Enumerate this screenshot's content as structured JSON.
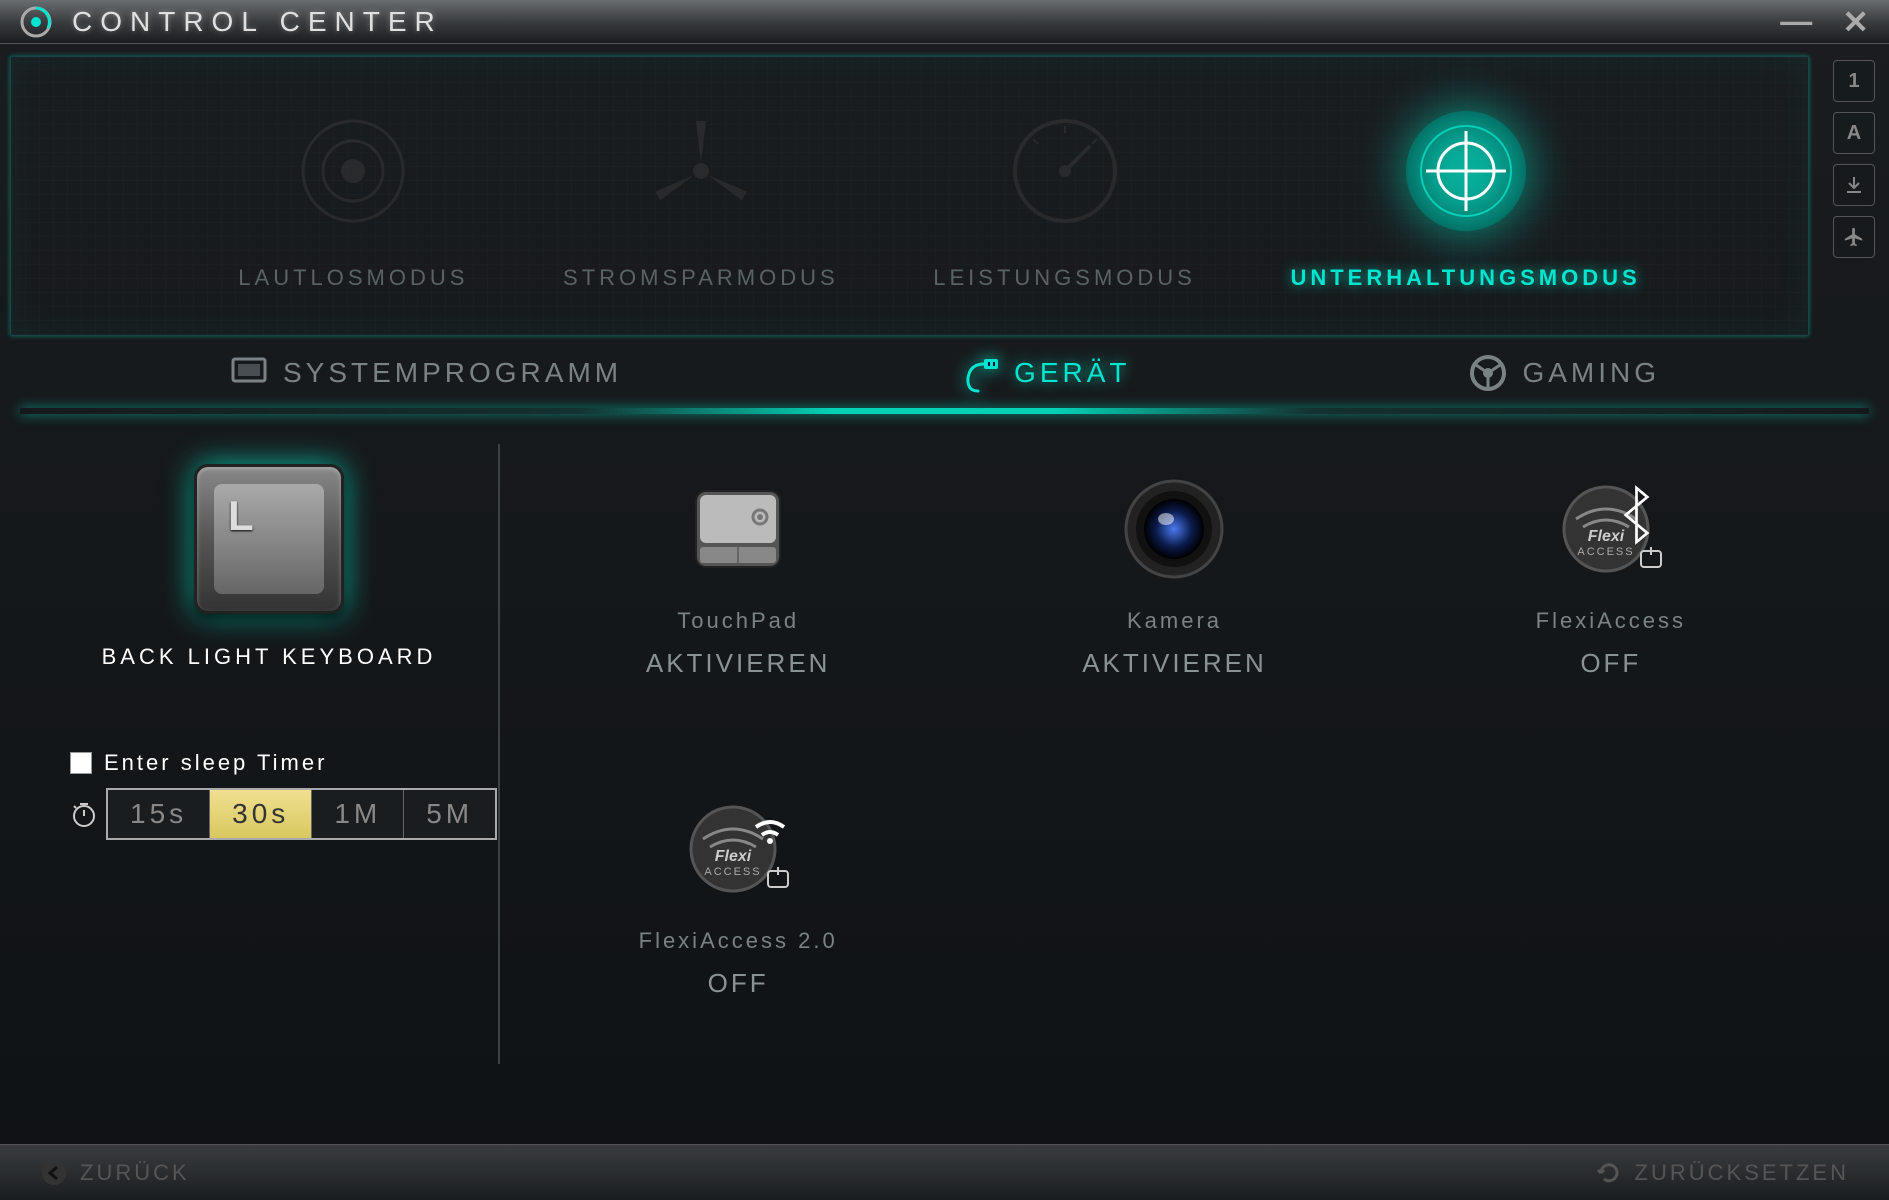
{
  "app": {
    "title": "CONTROL CENTER"
  },
  "modes": {
    "items": [
      {
        "label": "Lautlosmodus",
        "icon": "speaker"
      },
      {
        "label": "Stromsparmodus",
        "icon": "windmill"
      },
      {
        "label": "Leistungsmodus",
        "icon": "gauge"
      },
      {
        "label": "Unterhaltungsmodus",
        "icon": "target"
      }
    ],
    "activeIndex": 3
  },
  "sideIndicators": [
    "1",
    "A",
    "↓",
    "✈"
  ],
  "tabs": {
    "items": [
      {
        "label": "SYSTEMPROGRAMM",
        "icon": "monitor"
      },
      {
        "label": "GERÄT",
        "icon": "plug"
      },
      {
        "label": "GAMING",
        "icon": "wheel"
      }
    ],
    "activeIndex": 1
  },
  "backlight": {
    "label": "BACK LIGHT KEYBOARD",
    "keycap": "L"
  },
  "sleepTimer": {
    "label": "Enter sleep Timer",
    "checked": false,
    "options": [
      "15s",
      "30s",
      "1M",
      "5M"
    ],
    "selectedIndex": 1
  },
  "devices": [
    {
      "title": "TouchPad",
      "status": "AKTIVIEREN",
      "icon": "touchpad"
    },
    {
      "title": "Kamera",
      "status": "AKTIVIEREN",
      "icon": "camera"
    },
    {
      "title": "FlexiAccess",
      "status": "OFF",
      "icon": "flexi-bt"
    },
    {
      "title": "FlexiAccess 2.0",
      "status": "OFF",
      "icon": "flexi-wifi"
    }
  ],
  "footer": {
    "back": "ZURÜCK",
    "reset": "ZURÜCKSETZEN"
  },
  "colors": {
    "accent": "#00e5d0",
    "highlight": "#f0e090"
  }
}
